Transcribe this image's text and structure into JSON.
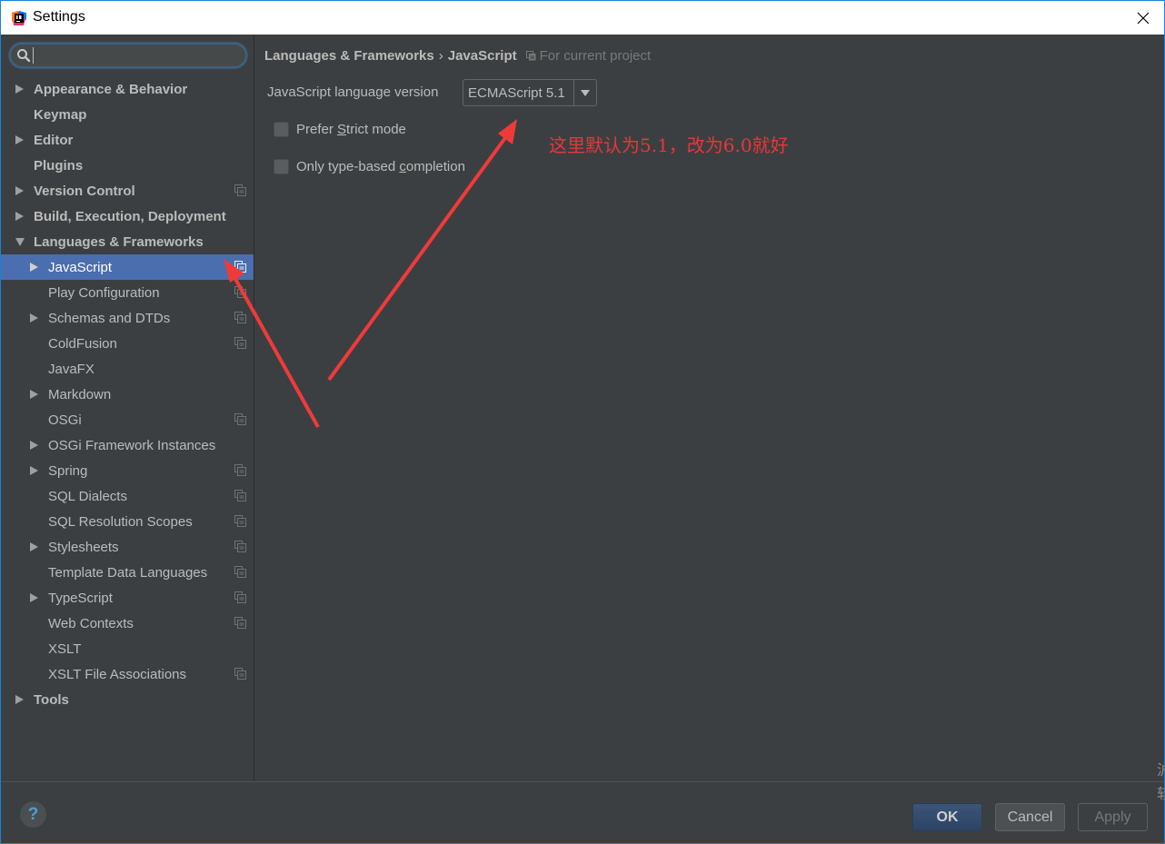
{
  "window": {
    "title": "Settings",
    "app_icon": "intellij-idea-icon",
    "close_icon": "close-icon"
  },
  "sidebar": {
    "search": {
      "value": "",
      "placeholder": ""
    },
    "items": [
      {
        "label": "Appearance & Behavior",
        "level": 0,
        "expander": "collapsed",
        "project_scope": false,
        "selected": false
      },
      {
        "label": "Keymap",
        "level": 0,
        "expander": "none",
        "project_scope": false,
        "selected": false
      },
      {
        "label": "Editor",
        "level": 0,
        "expander": "collapsed",
        "project_scope": false,
        "selected": false
      },
      {
        "label": "Plugins",
        "level": 0,
        "expander": "none",
        "project_scope": false,
        "selected": false
      },
      {
        "label": "Version Control",
        "level": 0,
        "expander": "collapsed",
        "project_scope": true,
        "selected": false
      },
      {
        "label": "Build, Execution, Deployment",
        "level": 0,
        "expander": "collapsed",
        "project_scope": false,
        "selected": false
      },
      {
        "label": "Languages & Frameworks",
        "level": 0,
        "expander": "expanded",
        "project_scope": false,
        "selected": false
      },
      {
        "label": "JavaScript",
        "level": 1,
        "expander": "collapsed",
        "project_scope": true,
        "selected": true
      },
      {
        "label": "Play Configuration",
        "level": 1,
        "expander": "none",
        "project_scope": true,
        "selected": false
      },
      {
        "label": "Schemas and DTDs",
        "level": 1,
        "expander": "collapsed",
        "project_scope": true,
        "selected": false
      },
      {
        "label": "ColdFusion",
        "level": 1,
        "expander": "none",
        "project_scope": true,
        "selected": false
      },
      {
        "label": "JavaFX",
        "level": 1,
        "expander": "none",
        "project_scope": false,
        "selected": false
      },
      {
        "label": "Markdown",
        "level": 1,
        "expander": "collapsed",
        "project_scope": false,
        "selected": false
      },
      {
        "label": "OSGi",
        "level": 1,
        "expander": "none",
        "project_scope": true,
        "selected": false
      },
      {
        "label": "OSGi Framework Instances",
        "level": 1,
        "expander": "collapsed",
        "project_scope": false,
        "selected": false
      },
      {
        "label": "Spring",
        "level": 1,
        "expander": "collapsed",
        "project_scope": true,
        "selected": false
      },
      {
        "label": "SQL Dialects",
        "level": 1,
        "expander": "none",
        "project_scope": true,
        "selected": false
      },
      {
        "label": "SQL Resolution Scopes",
        "level": 1,
        "expander": "none",
        "project_scope": true,
        "selected": false
      },
      {
        "label": "Stylesheets",
        "level": 1,
        "expander": "collapsed",
        "project_scope": true,
        "selected": false
      },
      {
        "label": "Template Data Languages",
        "level": 1,
        "expander": "none",
        "project_scope": true,
        "selected": false
      },
      {
        "label": "TypeScript",
        "level": 1,
        "expander": "collapsed",
        "project_scope": true,
        "selected": false
      },
      {
        "label": "Web Contexts",
        "level": 1,
        "expander": "none",
        "project_scope": true,
        "selected": false
      },
      {
        "label": "XSLT",
        "level": 1,
        "expander": "none",
        "project_scope": false,
        "selected": false
      },
      {
        "label": "XSLT File Associations",
        "level": 1,
        "expander": "none",
        "project_scope": true,
        "selected": false
      },
      {
        "label": "Tools",
        "level": 0,
        "expander": "collapsed",
        "project_scope": false,
        "selected": false
      }
    ]
  },
  "content": {
    "breadcrumb": {
      "parent": "Languages & Frameworks",
      "separator": "›",
      "current": "JavaScript",
      "scope_label": "For current project"
    },
    "language_version": {
      "label": "JavaScript language version",
      "selected": "ECMAScript 5.1"
    },
    "checkboxes": [
      {
        "pre": "Prefer ",
        "mnemonic": "S",
        "post": "trict mode",
        "checked": false
      },
      {
        "pre": "Only type-based ",
        "mnemonic": "c",
        "post": "ompletion",
        "checked": false
      }
    ],
    "annotation": {
      "text": "这里默认为5.1，改为6.0就好",
      "color": "#e8363a"
    }
  },
  "footer": {
    "help_label": "?",
    "ok_label": "OK",
    "cancel_label": "Cancel",
    "apply_label": "Apply",
    "apply_enabled": false
  },
  "edge_text": "沪\n软",
  "colors": {
    "accent_selected": "#4b6eaf",
    "background": "#3c3f41",
    "text": "#bbbbbb",
    "annotation_red": "#e8363a",
    "window_border": "#1883d7"
  }
}
